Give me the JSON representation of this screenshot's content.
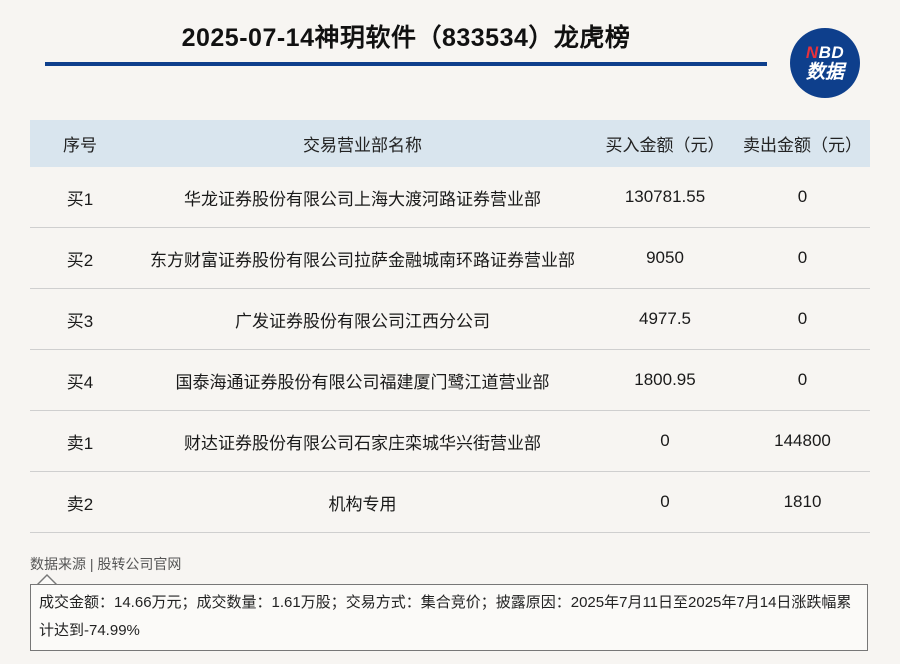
{
  "header": {
    "title": "2025-07-14神玥软件（833534）龙虎榜",
    "logo_top": "NBD",
    "logo_bottom": "数据"
  },
  "table": {
    "columns": [
      "序号",
      "交易营业部名称",
      "买入金额（元）",
      "卖出金额（元）"
    ],
    "rows": [
      {
        "seq": "买1",
        "name": "华龙证券股份有限公司上海大渡河路证券营业部",
        "buy": "130781.55",
        "sell": "0"
      },
      {
        "seq": "买2",
        "name": "东方财富证券股份有限公司拉萨金融城南环路证券营业部",
        "buy": "9050",
        "sell": "0"
      },
      {
        "seq": "买3",
        "name": "广发证券股份有限公司江西分公司",
        "buy": "4977.5",
        "sell": "0"
      },
      {
        "seq": "买4",
        "name": "国泰海通证券股份有限公司福建厦门鹭江道营业部",
        "buy": "1800.95",
        "sell": "0"
      },
      {
        "seq": "卖1",
        "name": "财达证券股份有限公司石家庄栾城华兴街营业部",
        "buy": "0",
        "sell": "144800"
      },
      {
        "seq": "卖2",
        "name": "机构专用",
        "buy": "0",
        "sell": "1810"
      }
    ]
  },
  "footer": {
    "source": "数据来源 | 股转公司官网",
    "note": "成交金额：14.66万元；成交数量：1.61万股；交易方式：集合竞价；披露原因：2025年7月11日至2025年7月14日涨跌幅累计达到-74.99%"
  },
  "colors": {
    "brand_blue": "#0e3f8c",
    "header_row": "#d9e5ee",
    "logo_accent": "#e8313c"
  }
}
